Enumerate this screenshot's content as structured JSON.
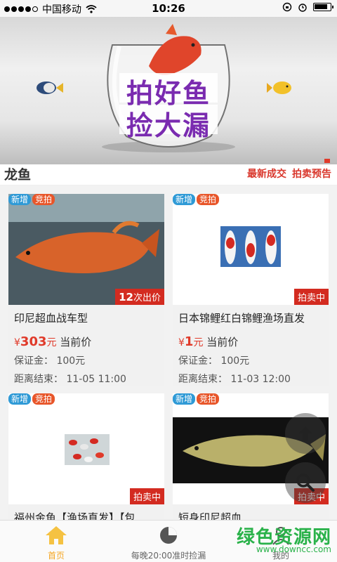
{
  "status_bar": {
    "carrier": "中国移动",
    "time": "10:26"
  },
  "banner": {
    "line1": "拍好鱼",
    "line2": "捡大漏"
  },
  "section": {
    "title": "龙鱼",
    "links": [
      "最新成交",
      "拍卖预告"
    ]
  },
  "tags": {
    "new": "新增",
    "auction": "竞拍"
  },
  "labels": {
    "current_price": "当前价",
    "deposit": "保证金：",
    "deadline": "距离结束：",
    "yen": "¥",
    "yuan": "元"
  },
  "cards": [
    {
      "name": "印尼超血战车型",
      "badge_count": "12",
      "badge_suffix": "次出价",
      "price": "303",
      "deposit": "100元",
      "end": "11-05 11:00"
    },
    {
      "name": "日本锦鲤红白锦鲤渔场直发",
      "badge": "拍卖中",
      "price": "1",
      "deposit": "100元",
      "end": "11-03 12:00"
    },
    {
      "name": "福州金鱼【渔场直发】【包",
      "badge": "拍卖中"
    },
    {
      "name": "短身印尼超血",
      "badge": "拍卖中"
    }
  ],
  "bottom_nav": [
    {
      "label": "首页",
      "icon": "home-icon",
      "active": true
    },
    {
      "label": "每晚20:00准时捡漏",
      "icon": "pie-chart-icon",
      "active": false
    },
    {
      "label": "我的",
      "icon": "user-icon",
      "active": false
    }
  ],
  "watermark": {
    "big": "绿色资源网",
    "small": "www.downcc.com"
  },
  "colors": {
    "accent_red": "#d9362b",
    "tag_blue": "#2f9ad6",
    "tag_orange": "#e8562a",
    "nav_active": "#f5a623"
  }
}
